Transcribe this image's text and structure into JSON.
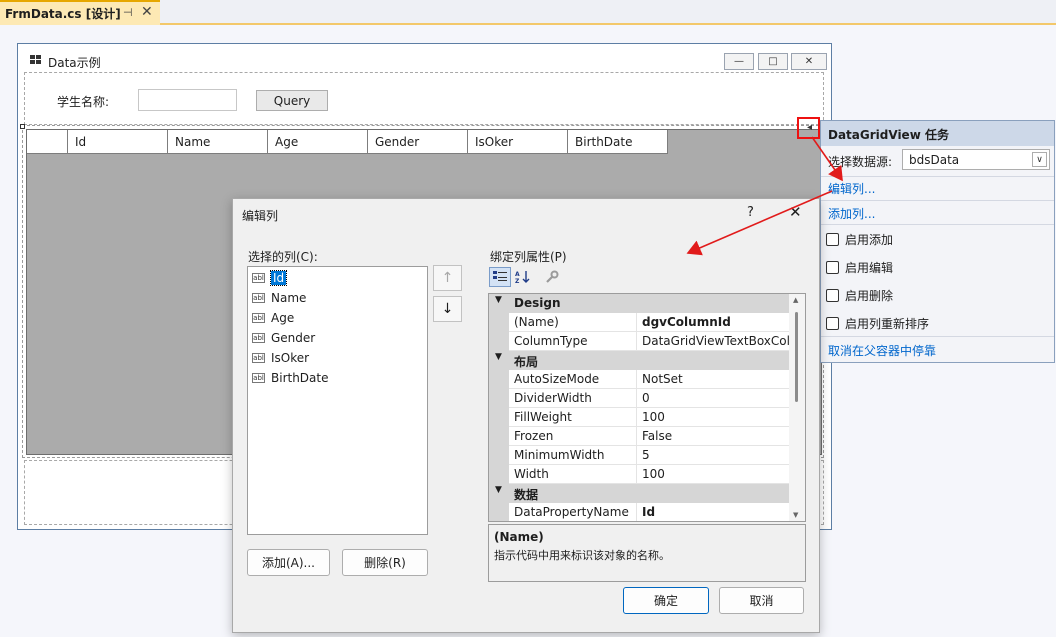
{
  "ide": {
    "tab_title": "FrmData.cs [设计]",
    "tab_pin": "⊣",
    "tab_close": "✕"
  },
  "form": {
    "title": "Data示例",
    "minimize_glyph": "—",
    "maximize_glyph": "□",
    "close_glyph": "✕",
    "student_label": "学生名称:",
    "student_value": "",
    "query_button": "Query",
    "grid_columns": [
      "Id",
      "Name",
      "Age",
      "Gender",
      "IsOker",
      "BirthDate"
    ]
  },
  "tasks": {
    "title": "DataGridView 任务",
    "datasource_label": "选择数据源:",
    "datasource_value": "bdsData",
    "edit_columns_link": "编辑列...",
    "add_column_link": "添加列...",
    "checkboxes": [
      {
        "label": "启用添加",
        "checked": false
      },
      {
        "label": "启用编辑",
        "checked": false
      },
      {
        "label": "启用删除",
        "checked": false
      },
      {
        "label": "启用列重新排序",
        "checked": false
      }
    ],
    "undock_link": "取消在父容器中停靠"
  },
  "dialog": {
    "title": "编辑列",
    "help": "?",
    "close": "✕",
    "selected_columns_label": "选择的列(C):",
    "bound_props_label": "绑定列属性(P)",
    "columns": [
      "Id",
      "Name",
      "Age",
      "Gender",
      "IsOker",
      "BirthDate"
    ],
    "selected_index": 0,
    "column_icon_text": "abl",
    "move_up": "↑",
    "move_down": "↓",
    "add_button": "添加(A)...",
    "remove_button": "删除(R)",
    "ok_button": "确定",
    "cancel_button": "取消",
    "toolbar": {
      "categorized_icon": "categorized-icon",
      "alphabetical_icon": "alphabetical-icon",
      "property_pages_icon": "wrench-icon"
    },
    "properties": [
      {
        "category": "Design",
        "rows": [
          {
            "name": "(Name)",
            "value": "dgvColumnId",
            "bold": true
          },
          {
            "name": "ColumnType",
            "value": "DataGridViewTextBoxColumn",
            "bold": false
          }
        ]
      },
      {
        "category": "布局",
        "rows": [
          {
            "name": "AutoSizeMode",
            "value": "NotSet",
            "bold": false
          },
          {
            "name": "DividerWidth",
            "value": "0",
            "bold": false
          },
          {
            "name": "FillWeight",
            "value": "100",
            "bold": false
          },
          {
            "name": "Frozen",
            "value": "False",
            "bold": false
          },
          {
            "name": "MinimumWidth",
            "value": "5",
            "bold": false
          },
          {
            "name": "Width",
            "value": "100",
            "bold": false
          }
        ]
      },
      {
        "category": "数据",
        "rows": [
          {
            "name": "DataPropertyName",
            "value": "Id",
            "bold": true
          }
        ]
      }
    ],
    "description_title": "(Name)",
    "description_text": "指示代码中用来标识该对象的名称。"
  },
  "colors": {
    "accent": "#0078d7",
    "annotation_arrow": "#e11b1b",
    "tab_active": "#fde9b4",
    "task_header": "#cdd8e8"
  }
}
